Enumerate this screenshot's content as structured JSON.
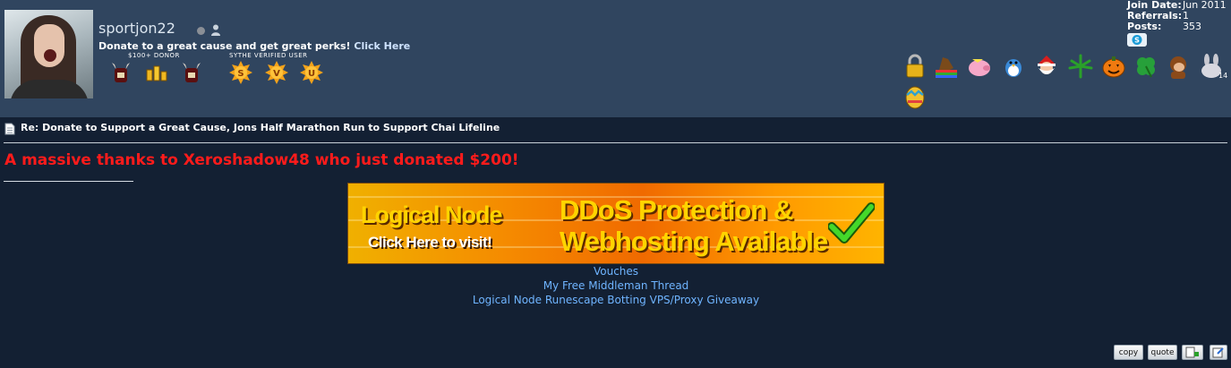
{
  "user": {
    "username": "sportjon22",
    "promo_text": "Donate to a great cause and get great perks!",
    "promo_link": "Click Here",
    "ranks": [
      "$100+ DONOR",
      "SYTHE VERIFIED USER"
    ]
  },
  "stats": [
    {
      "label": "Join Date:",
      "value": "Jun 2011"
    },
    {
      "label": "Referrals:",
      "value": "1"
    },
    {
      "label": "Posts:",
      "value": "353"
    }
  ],
  "awards": {
    "icons": [
      "lock-icon",
      "rainbow-horse-icon",
      "pink-pig-icon",
      "blue-bird-icon",
      "santa-icon",
      "leaf-icon",
      "pumpkin-icon",
      "clover-icon",
      "monkey-icon",
      "bunny-icon",
      "easter-egg-icon"
    ],
    "bunny_count": "14"
  },
  "post": {
    "title": "Re: Donate to Support a Great Cause, Jons Half Marathon Run to Support Chai Lifeline",
    "headline": "A massive thanks to Xeroshadow48 who just donated $200!"
  },
  "ad": {
    "brand": "Logical Node",
    "cta": "Click Here to visit!",
    "line1": "DDoS Protection &",
    "line2": "Webhosting Available"
  },
  "signature_links": [
    "Vouches",
    "My Free Middleman Thread",
    "Logical Node Runescape Botting VPS/Proxy Giveaway"
  ],
  "actions": {
    "copy": "copy",
    "quote": "quote"
  },
  "colors": {
    "header_bg": "#30455f",
    "body_bg": "#132033",
    "headline": "#ff1b1b",
    "link": "#6fb4ff"
  }
}
